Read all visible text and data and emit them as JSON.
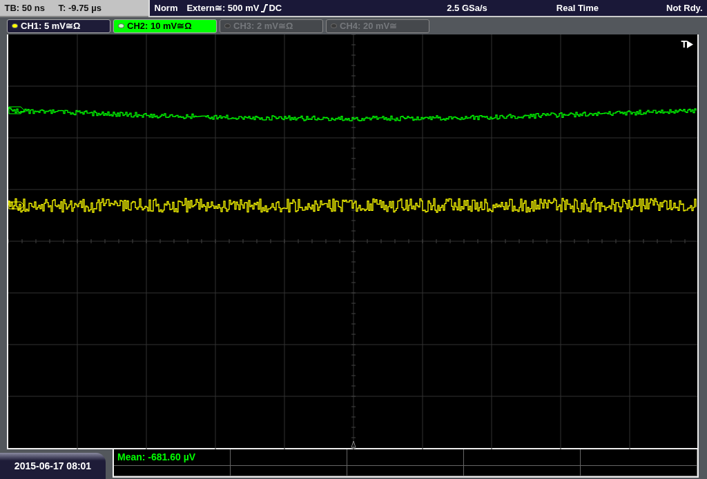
{
  "status_bar": {
    "timebase": "TB: 50 ns",
    "trigger_time": "T: -9.75 µs",
    "trigger_mode": "Norm",
    "trigger_source": "Extern≅: 500 mV",
    "trigger_coupling": "DC",
    "sample_rate": "2.5 GSa/s",
    "acquisition": "Real Time",
    "state": "Not Rdy."
  },
  "channels": [
    {
      "label": "CH1: 5 mV≅Ω",
      "on": true,
      "selected": false,
      "color": "#ffff00"
    },
    {
      "label": "CH2: 10 mV≅Ω",
      "on": true,
      "selected": true,
      "color": "#c8ffc8"
    },
    {
      "label": "CH3: 2 mV≅Ω",
      "on": false,
      "selected": false,
      "color": "#3a3a3a"
    },
    {
      "label": "CH4: 20 mV≅",
      "on": false,
      "selected": false,
      "color": "#3a3a3a"
    }
  ],
  "traces": [
    {
      "color": "#00ff00"
    },
    {
      "color": "#ffff00"
    }
  ],
  "trigger_label": "T",
  "date": "2015-06-17 08:01",
  "measurements": [
    {
      "text": "Mean: -681.60 µV"
    }
  ]
}
